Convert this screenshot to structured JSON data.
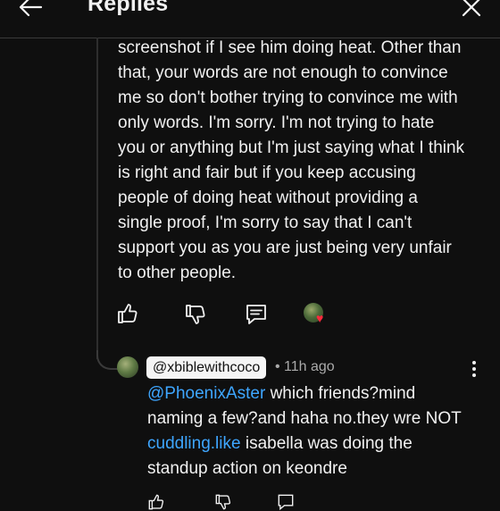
{
  "header": {
    "title": "Replies"
  },
  "comment": {
    "lines": [
      "screenshot if I see him doing heat. Other than",
      "that, your words are not enough to convince",
      "me so don't bother trying to convince me with",
      "only words. I'm sorry. I'm not trying to hate",
      "you or anything but I'm just saying what I think",
      "is right and fair but if you keep accusing",
      "people of doing heat without providing a",
      "single proof, I'm sorry to say that I can't",
      "support you as you are just being very unfair",
      "to other people."
    ]
  },
  "reply": {
    "handle": "@xbiblewithcoco",
    "meta": "• 11h ago",
    "mention": "@PhoenixAster",
    "line1_rest": " which friends?mind",
    "line2": "naming a few?and haha no.they wre NOT",
    "link2": "cuddling.like",
    "line3_rest": " isabella was doing the",
    "line4": "standup action on keondre"
  },
  "colors": {
    "link": "#3ea6ff",
    "heart": "#ff2a3d",
    "background": "#0f0f0f"
  }
}
